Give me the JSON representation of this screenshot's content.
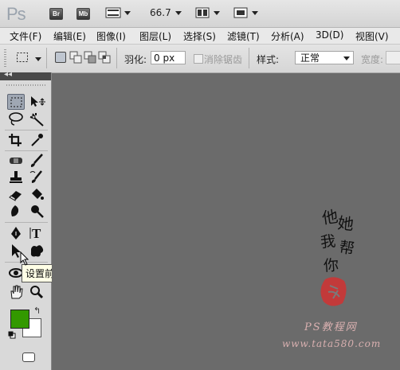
{
  "app": {
    "logo": "Ps",
    "bridge_badge": "Br",
    "minibridge_badge": "Mb",
    "zoom": "66.7"
  },
  "menu": [
    "文件(F)",
    "编辑(E)",
    "图像(I)",
    "图层(L)",
    "选择(S)",
    "滤镜(T)",
    "分析(A)",
    "3D(D)",
    "视图(V)"
  ],
  "options": {
    "feather_label": "羽化:",
    "feather_value": "0 px",
    "antialias_label": "消除锯齿",
    "style_label": "样式:",
    "style_value": "正常",
    "width_label": "宽度:"
  },
  "toolbox": {
    "collapse_glyph": "◂◂"
  },
  "tooltip": "设置前景色",
  "colors": {
    "foreground": "#339900",
    "background": "#ffffff"
  },
  "watermark": {
    "signature_chars": [
      "他",
      "她",
      "我",
      "帮",
      "你"
    ],
    "seal_alt": "red seal stamp",
    "line1": "PS教程网",
    "line2": "www.tata580.com"
  }
}
